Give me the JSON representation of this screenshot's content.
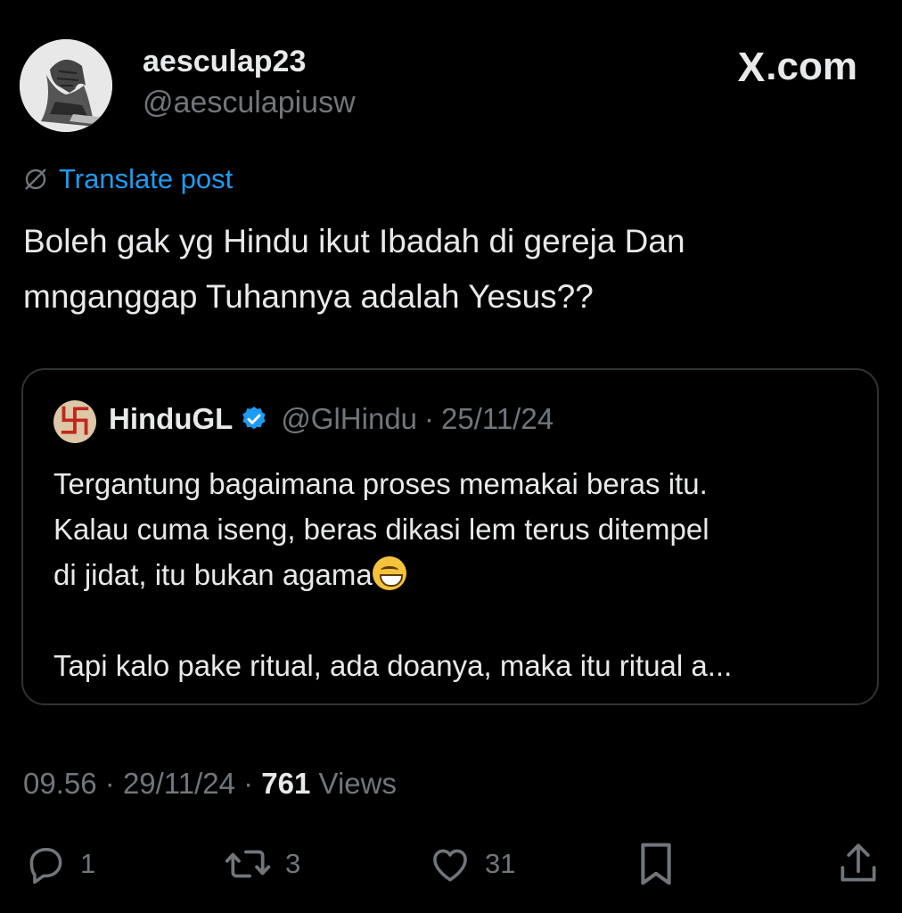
{
  "author": {
    "name": "aesculap23",
    "handle": "@aesculapiusw",
    "avatar_icon": "profile-sketch-avatar"
  },
  "brand": {
    "logo": "X",
    "suffix": ".com"
  },
  "translate": {
    "label": "Translate post",
    "icon": "globe-slash-icon"
  },
  "tweet": {
    "lines": [
      "Boleh gak yg Hindu ikut Ibadah di gereja Dan",
      "mnganggap Tuhannya adalah Yesus??"
    ]
  },
  "quote": {
    "name": "HinduGL",
    "handle": "@GlHindu",
    "separator": "·",
    "date": "25/11/24",
    "verified_icon": "verified-badge-icon",
    "avatar_glyph": "卐",
    "lines": [
      "Tergantung bagaimana proses memakai beras itu.",
      "Kalau cuma iseng, beras dikasi lem terus ditempel",
      "di jidat, itu bukan agama",
      "",
      "Tapi kalo pake ritual, ada doanya, maka itu ritual a..."
    ],
    "emoji": "grinning-face"
  },
  "meta": {
    "time": "09.56",
    "separator": "·",
    "date": "29/11/24",
    "views_count": "761",
    "views_label": "Views"
  },
  "actions": {
    "replies": "1",
    "reposts": "3",
    "likes": "31"
  },
  "colors": {
    "background": "#000000",
    "text": "#e7e9ea",
    "muted": "#71767b",
    "link": "#1d9bf0",
    "border": "#2f3336"
  }
}
